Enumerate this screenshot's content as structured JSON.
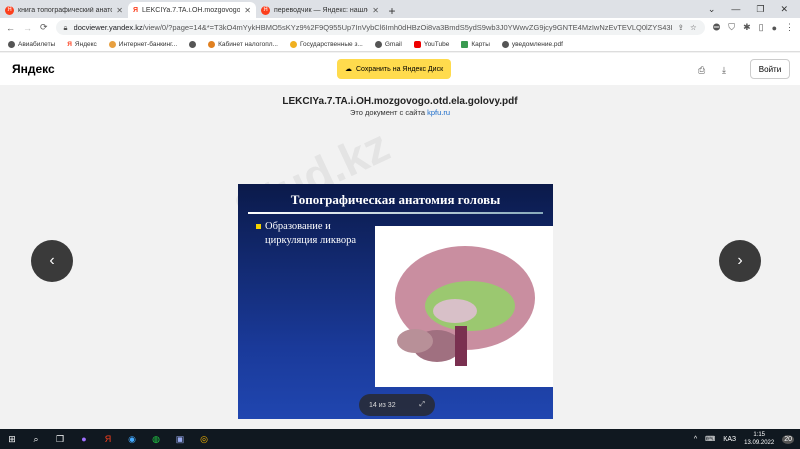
{
  "tabs": [
    {
      "label": "книга топографический анатом"
    },
    {
      "label": "LEKCIYa.7.TA.i.OH.mozgovogo.ot"
    },
    {
      "label": "переводчик — Яндекс: нашлос"
    }
  ],
  "address": {
    "host": "docviewer.yandex.kz",
    "path": "/view/0/?page=14&*=T3kO4mYykHBMO5sKYz9%2F9Q955Up7InVybCl6Imh0dHBzOi8va3BmdS5ydS9wb3J0YWwvZG9jcy9GNTE4MzIwNzEvTEVLQ0lZYS43LlRBL"
  },
  "bookmarks": [
    "Авиабилеты",
    "Яндекс",
    "Интернет-банкинг...",
    "",
    "Кабинет налогопл...",
    "Государственные з...",
    "Gmail",
    "YouTube",
    "Карты",
    "уведомление.pdf"
  ],
  "header": {
    "logo": "Яндекс",
    "save_label": "Сохранить на Яндекс Диск",
    "login_label": "Войти"
  },
  "document": {
    "title": "LEKCIYa.7.TA.i.OH.mozgovogo.otd.ela.golovy.pdf",
    "source_prefix": "Это документ с сайта",
    "source_link": "kpfu.ru"
  },
  "slide": {
    "title": "Топографическая анатомия головы",
    "bullet": "Образование и циркуляция ликвора"
  },
  "pager": {
    "text": "14 из 32"
  },
  "watermark": "Stud.kz",
  "taskbar": {
    "lang": "КАЗ",
    "time": "1:15",
    "date": "13.09.2022",
    "notifications": "20"
  }
}
